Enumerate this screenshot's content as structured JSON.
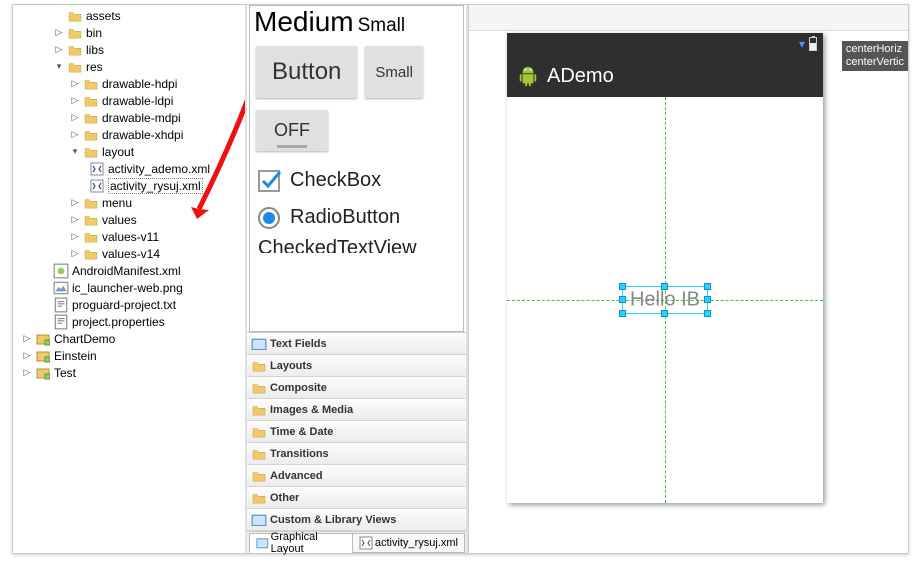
{
  "tree": {
    "assets": "assets",
    "bin": "bin",
    "libs": "libs",
    "res": "res",
    "drawable_hdpi": "drawable-hdpi",
    "drawable_ldpi": "drawable-ldpi",
    "drawable_mdpi": "drawable-mdpi",
    "drawable_xhdpi": "drawable-xhdpi",
    "layout": "layout",
    "activity_ademo": "activity_ademo.xml",
    "activity_rysuj": "activity_rysuj.xml",
    "menu": "menu",
    "values": "values",
    "values_v11": "values-v11",
    "values_v14": "values-v14",
    "android_manifest": "AndroidManifest.xml",
    "ic_launcher": "ic_launcher-web.png",
    "proguard": "proguard-project.txt",
    "project_props": "project.properties",
    "chart_demo": "ChartDemo",
    "einstein": "Einstein",
    "test": "Test"
  },
  "palette": {
    "medium": "Medium",
    "small_text": "Small",
    "button": "Button",
    "small_btn": "Small",
    "off": "OFF",
    "checkbox": "CheckBox",
    "radiobutton": "RadioButton",
    "checkedtextview": "CheckedTextView",
    "categories": {
      "text_fields": "Text Fields",
      "layouts": "Layouts",
      "composite": "Composite",
      "images_media": "Images & Media",
      "time_date": "Time & Date",
      "transitions": "Transitions",
      "advanced": "Advanced",
      "other": "Other",
      "custom": "Custom & Library Views"
    }
  },
  "tabs": {
    "graphical": "Graphical Layout",
    "xml": "activity_rysuj.xml"
  },
  "preview": {
    "app_title": "ADemo",
    "widget_text": "Hello IB",
    "hint1": "centerHoriz",
    "hint2": "centerVertic"
  }
}
